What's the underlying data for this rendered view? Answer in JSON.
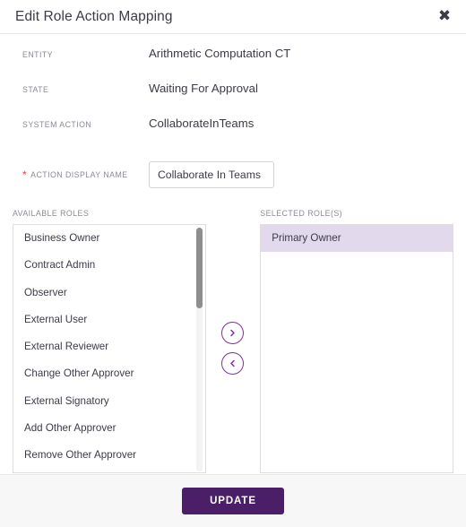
{
  "dialog": {
    "title": "Edit Role Action Mapping",
    "close_icon": "close-icon"
  },
  "fields": [
    {
      "label": "ENTITY",
      "value": "Arithmetic Computation CT",
      "required": false
    },
    {
      "label": "STATE",
      "value": "Waiting For Approval",
      "required": false
    },
    {
      "label": "SYSTEM ACTION",
      "value": "CollaborateInTeams",
      "required": false
    }
  ],
  "action_display_name": {
    "label": "ACTION DISPLAY NAME",
    "required_marker": "*",
    "value": "Collaborate In Teams",
    "placeholder": ""
  },
  "available_roles": {
    "caption": "AVAILABLE ROLES",
    "items": [
      "Business Owner",
      "Contract Admin",
      "Observer",
      "External User",
      "External Reviewer",
      "Change Other Approver",
      "External Signatory",
      "Add Other Approver",
      "Remove Other Approver"
    ]
  },
  "selected_roles": {
    "caption": "SELECTED ROLE(S)",
    "items": [
      {
        "label": "Primary Owner",
        "selected": true
      }
    ]
  },
  "transfer_buttons": {
    "move_right_icon": "chevron-right-icon",
    "move_left_icon": "chevron-left-icon"
  },
  "footer": {
    "update_label": "UPDATE"
  },
  "colors": {
    "accent_purple": "#7b31a6",
    "button_purple": "#4a1f68",
    "selection_lavender": "#e3d9ec",
    "required_red": "#e8413c"
  }
}
